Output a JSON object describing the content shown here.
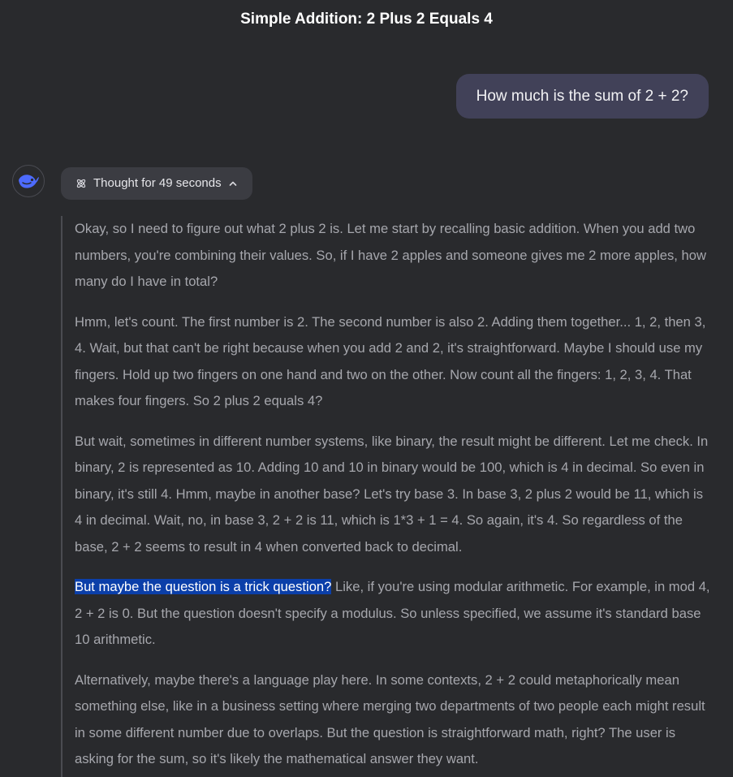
{
  "conversation": {
    "title": "Simple Addition: 2 Plus 2 Equals 4"
  },
  "user_message": {
    "text": "How much is the sum of 2 + 2?"
  },
  "assistant": {
    "avatar_icon": "whale-logo-icon",
    "brand_color": "#4d6bfe",
    "thought_toggle": {
      "label": "Thought for 49 seconds",
      "icon": "atom-icon",
      "chevron": "chevron-up-icon"
    },
    "thinking": {
      "p1": "Okay, so I need to figure out what 2 plus 2 is. Let me start by recalling basic addition. When you add two numbers, you're combining their values. So, if I have 2 apples and someone gives me 2 more apples, how many do I have in total?",
      "p2": "Hmm, let's count. The first number is 2. The second number is also 2. Adding them together... 1, 2, then 3, 4. Wait, but that can't be right because when you add 2 and 2, it's straightforward. Maybe I should use my fingers. Hold up two fingers on one hand and two on the other. Now count all the fingers: 1, 2, 3, 4. That makes four fingers. So 2 plus 2 equals 4?",
      "p3": "But wait, sometimes in different number systems, like binary, the result might be different. Let me check. In binary, 2 is represented as 10. Adding 10 and 10 in binary would be 100, which is 4 in decimal. So even in binary, it's still 4. Hmm, maybe in another base? Let's try base 3. In base 3, 2 plus 2 would be 11, which is 4 in decimal. Wait, no, in base 3, 2 + 2 is 11, which is 1*3 + 1 = 4. So again, it's 4. So regardless of the base, 2 + 2 seems to result in 4 when converted back to decimal.",
      "p4_selected": "But maybe the question is a trick question?",
      "p4_rest": " Like, if you're using modular arithmetic. For example, in mod 4, 2 + 2 is 0. But the question doesn't specify a modulus. So unless specified, we assume it's standard base 10 arithmetic.",
      "p5": "Alternatively, maybe there's a language play here. In some contexts, 2 + 2 could metaphorically mean something else, like in a business setting where merging two departments of two people each might result in some different number due to overlaps. But the question is straightforward math, right? The user is asking for the sum, so it's likely the mathematical answer they want."
    }
  }
}
